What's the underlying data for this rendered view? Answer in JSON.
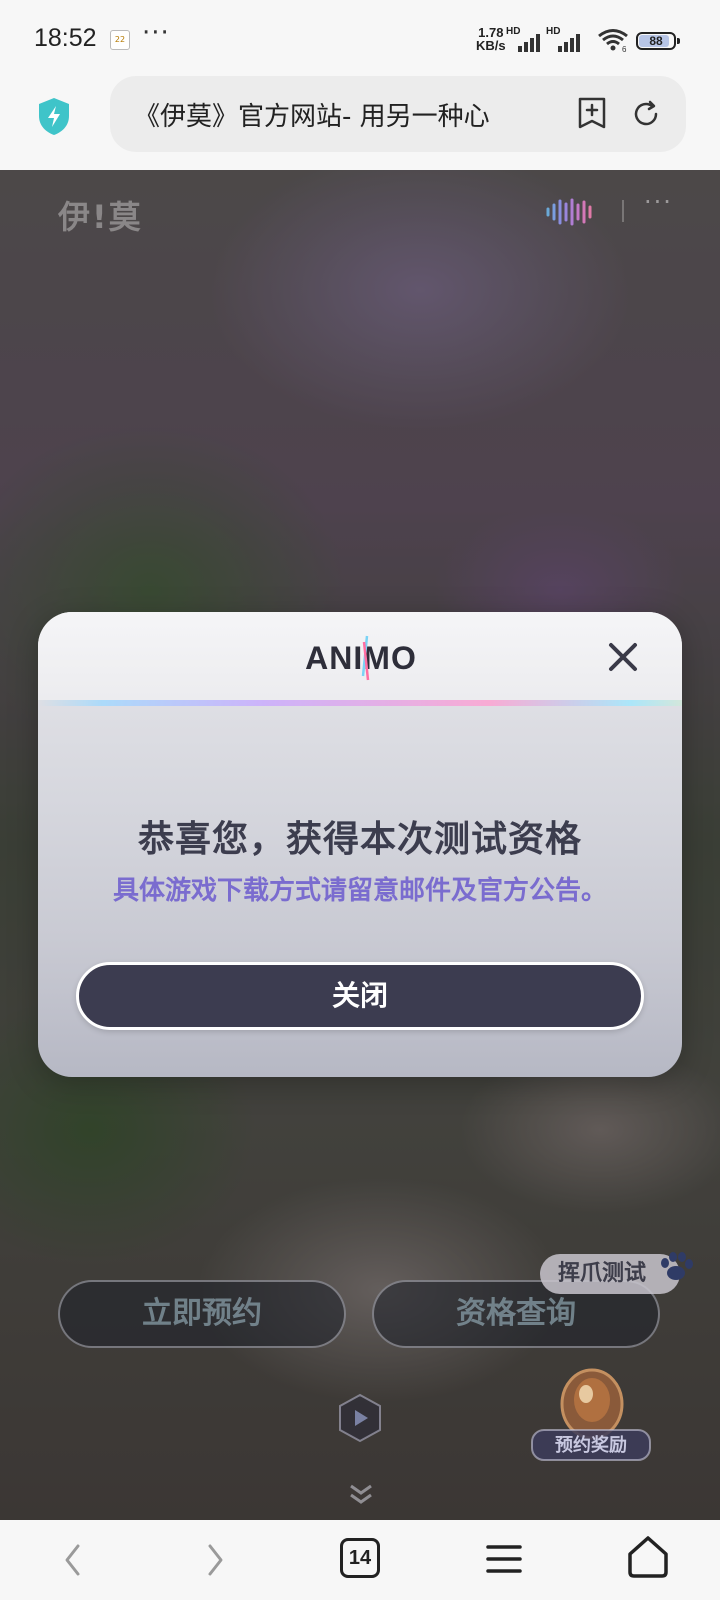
{
  "status_bar": {
    "time": "18:52",
    "calendar_day": "22",
    "more": "···",
    "net_speed_value": "1.78",
    "net_speed_unit": "KB/s",
    "hd1": "HD",
    "hd2": "HD",
    "wifi_sub": "6",
    "battery": "88"
  },
  "browser": {
    "url_title": "《伊莫》官方网站- 用另一种心"
  },
  "site": {
    "logo_text": "伊!莫",
    "more": "···",
    "reserve_button": "立即预约",
    "query_button": "资格查询",
    "test_tag": "挥爪测试",
    "reward_label": "预约奖励"
  },
  "modal": {
    "logo_text": "ANIMO",
    "title": "恭喜您，获得本次测试资格",
    "subtitle": "具体游戏下载方式请留意邮件及官方公告。",
    "close_button": "关闭"
  },
  "bottom_nav": {
    "tabs_count": "14"
  },
  "colors": {
    "accent_purple": "#7a6ccf",
    "title_dark": "#3c3d4e",
    "button_dark": "#3c3c50"
  }
}
